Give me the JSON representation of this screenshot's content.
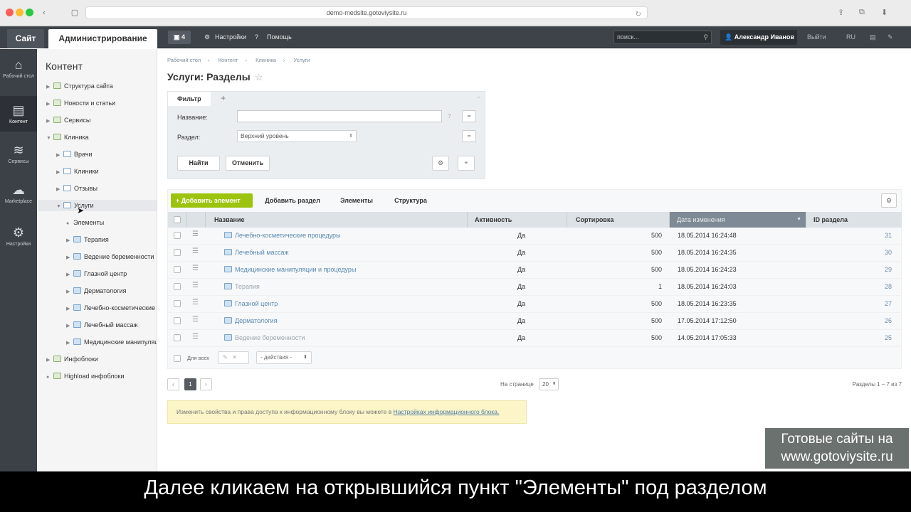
{
  "browser": {
    "url": "demo-medsite.gotoviysite.ru"
  },
  "adminbar": {
    "site_tab": "Сайт",
    "admin_tab": "Администрирование",
    "notifications": "4",
    "settings": "Настройки",
    "help": "Помощь",
    "search_placeholder": "поиск...",
    "user": "Александр Иванов",
    "logout": "Выйти",
    "lang": "RU"
  },
  "leftbar": {
    "items": [
      {
        "label": "Рабочий стол",
        "icon": "home-icon"
      },
      {
        "label": "Контент",
        "icon": "document-icon"
      },
      {
        "label": "Сервисы",
        "icon": "layers-icon"
      },
      {
        "label": "Marketplace",
        "icon": "cloud-icon"
      },
      {
        "label": "Настройки",
        "icon": "gear-icon"
      }
    ]
  },
  "tree": {
    "title": "Контент",
    "nodes": [
      "Структура сайта",
      "Новости и статьи",
      "Сервисы",
      "Клиника",
      "Врачи",
      "Клиники",
      "Отзывы",
      "Услуги",
      "Элементы",
      "Терапия",
      "Ведение беременности",
      "Глазной центр",
      "Дерматология",
      "Лечебно-косметические",
      "Лечебный массаж",
      "Медицинские манипуляц",
      "Инфоблоки",
      "Highload инфоблоки"
    ]
  },
  "breadcrumbs": [
    "Рабочий стол",
    "Контент",
    "Клиника",
    "Услуги"
  ],
  "page_title": "Услуги: Разделы",
  "filter": {
    "tab": "Фильтр",
    "name_label": "Название:",
    "section_label": "Раздел:",
    "section_value": "Верхний уровень",
    "find": "Найти",
    "cancel": "Отменить"
  },
  "toolbar": {
    "add_element": "Добавить элемент",
    "add_section": "Добавить раздел",
    "elements": "Элементы",
    "structure": "Структура"
  },
  "table": {
    "columns": [
      "Название",
      "Активность",
      "Сортировка",
      "Дата изменения",
      "ID раздела"
    ],
    "rows": [
      {
        "name": "Лечебно-косметические процедуры",
        "active": "Да",
        "sort": "500",
        "date": "18.05.2014 16:24:48",
        "id": "31"
      },
      {
        "name": "Лечебный массаж",
        "active": "Да",
        "sort": "500",
        "date": "18.05.2014 16:24:35",
        "id": "30"
      },
      {
        "name": "Медицинские манипуляции и процедуры",
        "active": "Да",
        "sort": "500",
        "date": "18.05.2014 16:24:23",
        "id": "29"
      },
      {
        "name": "Терапия",
        "active": "Да",
        "sort": "1",
        "date": "18.05.2014 16:24:03",
        "id": "28"
      },
      {
        "name": "Глазной центр",
        "active": "Да",
        "sort": "500",
        "date": "18.05.2014 16:23:35",
        "id": "27"
      },
      {
        "name": "Дерматология",
        "active": "Да",
        "sort": "500",
        "date": "17.05.2014 17:12:50",
        "id": "26"
      },
      {
        "name": "Ведение беременности",
        "active": "Да",
        "sort": "500",
        "date": "14.05.2014 17:05:33",
        "id": "25"
      }
    ],
    "for_all": "Для всех",
    "actions": "- действия -"
  },
  "pagination": {
    "current": "1",
    "on_page_label": "На странице",
    "page_size": "20",
    "range": "Разделы 1 – 7 из 7"
  },
  "notice": {
    "text": "Изменить свойства и права доступа к информационному блоку вы можете в ",
    "link": "Настройках информационного блока."
  },
  "watermark": {
    "line1": "Готовые сайты на",
    "line2": "www.gotoviysite.ru"
  },
  "subtitle": "Далее кликаем на открывшийся пункт \"Элементы\" под разделом"
}
